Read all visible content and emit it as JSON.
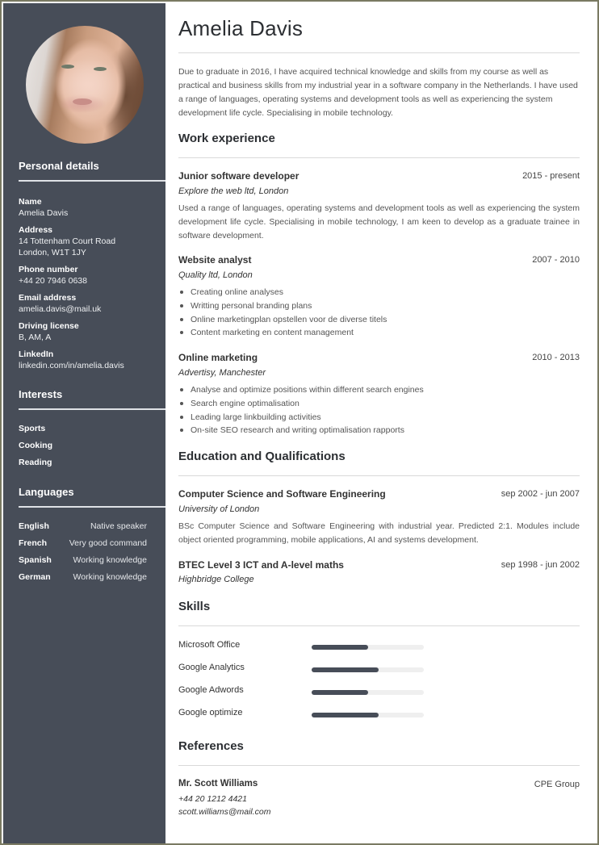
{
  "profile": {
    "name": "Amelia Davis",
    "summary": "Due to graduate in 2016, I have acquired technical knowledge and skills from my course as well as practical and business skills from my industrial year in a software company in the Netherlands. I have used a range of languages, operating systems and development tools as well as experiencing the system development life cycle. Specialising in mobile technology."
  },
  "sidebar": {
    "photo_alt": "profile-photo",
    "personal_details": {
      "title": "Personal details",
      "fields": [
        {
          "label": "Name",
          "value": "Amelia Davis"
        },
        {
          "label": "Address",
          "value": "14 Tottenham Court Road",
          "value2": "London, W1T 1JY"
        },
        {
          "label": "Phone number",
          "value": "+44 20 7946 0638"
        },
        {
          "label": "Email address",
          "value": "amelia.davis@mail.uk"
        },
        {
          "label": "Driving license",
          "value": "B, AM, A"
        },
        {
          "label": "LinkedIn",
          "value": "linkedin.com/in/amelia.davis"
        }
      ]
    },
    "interests": {
      "title": "Interests",
      "items": [
        "Sports",
        "Cooking",
        "Reading"
      ]
    },
    "languages": {
      "title": "Languages",
      "items": [
        {
          "language": "English",
          "level": "Native speaker"
        },
        {
          "language": "French",
          "level": "Very good command"
        },
        {
          "language": "Spanish",
          "level": "Working knowledge"
        },
        {
          "language": "German",
          "level": "Working knowledge"
        }
      ]
    }
  },
  "work": {
    "title": "Work experience",
    "jobs": [
      {
        "title": "Junior software developer",
        "date": "2015 - present",
        "org": "Explore the web ltd, London",
        "description": "Used a range of languages, operating systems and development tools as well as experiencing the system development life cycle. Specialising in mobile technology, I am keen to develop as a graduate trainee in software development."
      },
      {
        "title": "Website analyst",
        "date": "2007 - 2010",
        "org": "Quality ltd, London",
        "bullets": [
          "Creating online analyses",
          "Writting personal branding plans",
          "Online marketingplan opstellen voor de diverse titels",
          "Content marketing en content management"
        ]
      },
      {
        "title": "Online marketing",
        "date": "2010 - 2013",
        "org": "Advertisy, Manchester",
        "bullets": [
          "Analyse and optimize positions within different search engines",
          "Search engine optimalisation",
          "Leading large linkbuilding activities",
          "On-site SEO research and writing optimalisation rapports"
        ]
      }
    ]
  },
  "education": {
    "title": "Education and Qualifications",
    "items": [
      {
        "title": "Computer Science and Software Engineering",
        "date": "sep 2002 - jun 2007",
        "org": "University of London",
        "description": "BSc Computer Science and Software Engineering with industrial year. Predicted 2:1. Modules include object oriented programming, mobile applications, AI and systems development."
      },
      {
        "title": "BTEC Level 3 ICT and A-level maths",
        "date": "sep 1998 - jun 2002",
        "org": "Highbridge College"
      }
    ]
  },
  "skills": {
    "title": "Skills",
    "items": [
      {
        "name": "Microsoft Office",
        "level_percent": 50
      },
      {
        "name": "Google Analytics",
        "level_percent": 60
      },
      {
        "name": "Google Adwords",
        "level_percent": 50
      },
      {
        "name": "Google optimize",
        "level_percent": 60
      }
    ]
  },
  "references": {
    "title": "References",
    "items": [
      {
        "name": "Mr. Scott Williams",
        "org": "CPE Group",
        "phone": "+44 20 1212 4421",
        "email": "scott.williams@mail.com"
      }
    ]
  },
  "colors": {
    "sidebar_bg": "#474d58",
    "frame_border": "#7a7a62",
    "skill_fill": "#474d58",
    "skill_track": "#efefef",
    "rule": "#d9d9d9"
  }
}
